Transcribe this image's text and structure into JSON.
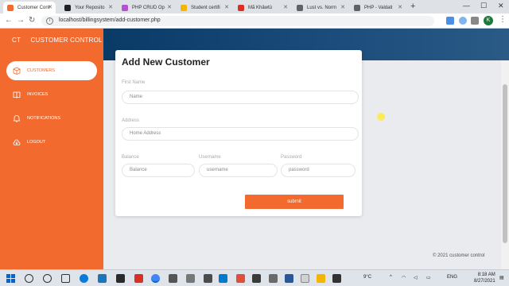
{
  "browser": {
    "tabs": [
      {
        "label": "Customer Cont",
        "active": true,
        "color": "#f26a2e"
      },
      {
        "label": "Your Reposito",
        "active": false,
        "color": "#222222"
      },
      {
        "label": "PHP CRUD Op",
        "active": false,
        "color": "#b44fd6"
      },
      {
        "label": "Student certifi",
        "active": false,
        "color": "#f4b400"
      },
      {
        "label": "Mã Khâwtü",
        "active": false,
        "color": "#d93025"
      },
      {
        "label": "Lust vs. Norm",
        "active": false,
        "color": "#5f6368"
      },
      {
        "label": "PHP - Valdati",
        "active": false,
        "color": "#5f6368"
      }
    ],
    "url": "localhost/billingsystem/add-customer.php",
    "profile_initial": "K"
  },
  "sidebar": {
    "brand_abbr": "CT",
    "brand_name": "CUSTOMER CONTROL",
    "items": [
      {
        "label": "CUSTOMERS",
        "icon": "box-icon",
        "active": true
      },
      {
        "label": "INVOICES",
        "icon": "book-icon",
        "active": false
      },
      {
        "label": "NOTIFICATIONS",
        "icon": "bell-icon",
        "active": false
      },
      {
        "label": "LOGOUT",
        "icon": "logout-icon",
        "active": false
      }
    ]
  },
  "form": {
    "title": "Add New Customer",
    "first_name": {
      "label": "First Name",
      "placeholder": "Name"
    },
    "address": {
      "label": "Address",
      "placeholder": "Home Address"
    },
    "balance": {
      "label": "Balance",
      "placeholder": "Balance"
    },
    "username": {
      "label": "Username",
      "placeholder": "username"
    },
    "password": {
      "label": "Password",
      "placeholder": "password"
    },
    "submit_label": "submit"
  },
  "footer": {
    "copyright": "© 2021 customer control"
  },
  "taskbar": {
    "weather": "9°C",
    "language": "ENG",
    "time": "8:18 AM",
    "date": "8/27/2021"
  },
  "colors": {
    "accent": "#f26a2e",
    "header_band": "#1c4d7c"
  }
}
